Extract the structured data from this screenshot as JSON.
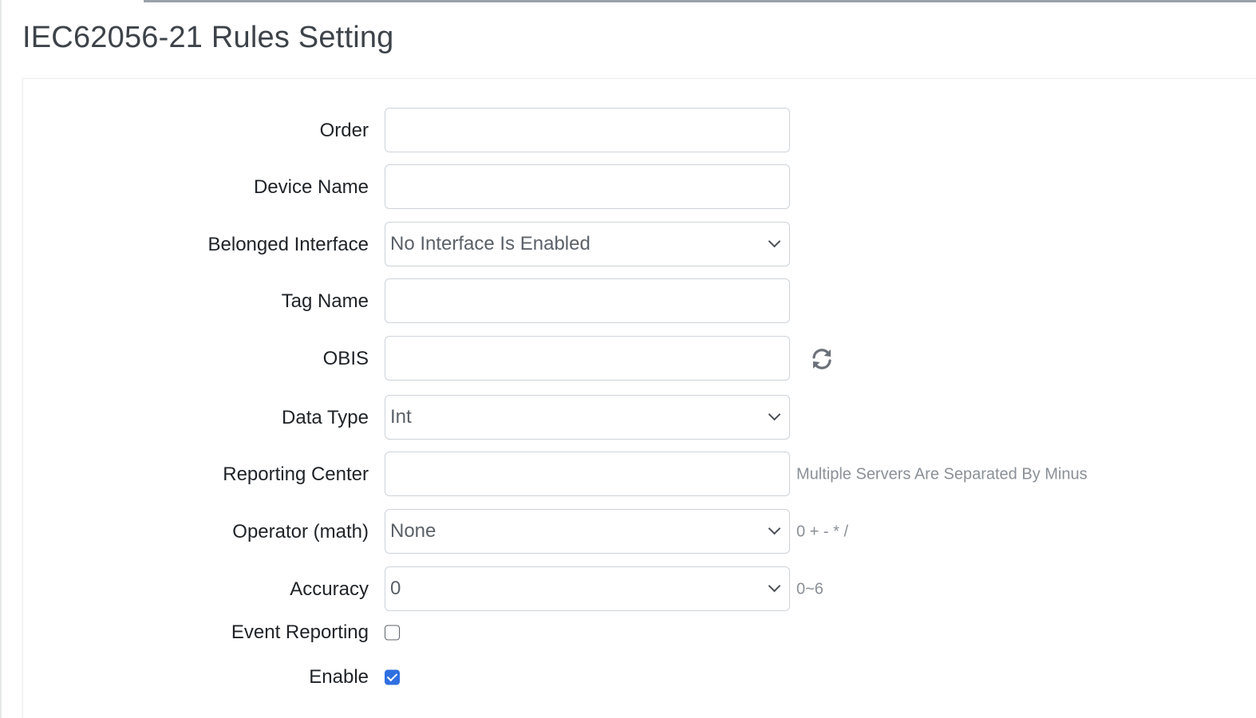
{
  "page": {
    "title": "IEC62056-21 Rules Setting"
  },
  "form": {
    "order": {
      "label": "Order",
      "value": ""
    },
    "device_name": {
      "label": "Device Name",
      "value": ""
    },
    "belonged_interface": {
      "label": "Belonged Interface",
      "selected": "No Interface Is Enabled"
    },
    "tag_name": {
      "label": "Tag Name",
      "value": ""
    },
    "obis": {
      "label": "OBIS",
      "value": "",
      "action_icon": "refresh-icon"
    },
    "data_type": {
      "label": "Data Type",
      "selected": "Int"
    },
    "reporting_center": {
      "label": "Reporting Center",
      "value": "",
      "hint": "Multiple Servers Are Separated By Minus"
    },
    "operator": {
      "label": "Operator (math)",
      "selected": "None",
      "hint": "0 + - * /"
    },
    "accuracy": {
      "label": "Accuracy",
      "selected": "0",
      "hint": "0~6"
    },
    "event_reporting": {
      "label": "Event Reporting",
      "checked": false
    },
    "enable": {
      "label": "Enable",
      "checked": true
    }
  },
  "colors": {
    "checkbox_checked": "#2f6fe0",
    "hint_text": "#8a9096",
    "label_text": "#1f2327"
  }
}
